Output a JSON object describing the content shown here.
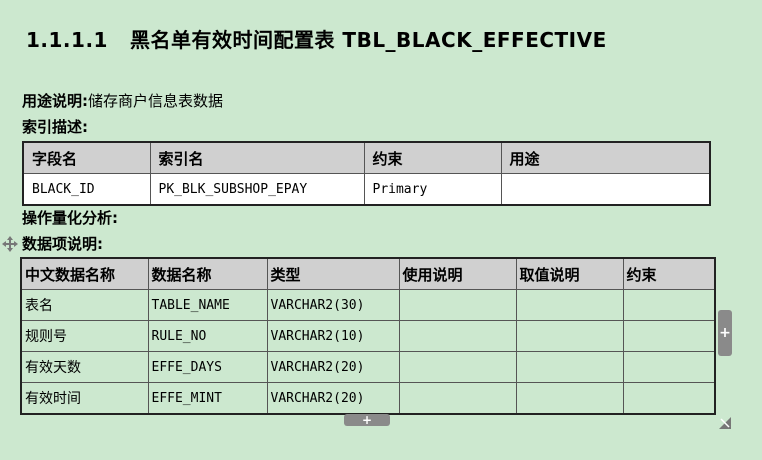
{
  "heading": {
    "number": "1.1.1.1",
    "title": "黑名单有效时间配置表 TBL_BLACK_EFFECTIVE"
  },
  "purpose": {
    "label": "用途说明:",
    "value": "储存商户信息表数据"
  },
  "index_label": "索引描述:",
  "index_table": {
    "headers": [
      "字段名",
      "索引名",
      "约束",
      "用途"
    ],
    "rows": [
      [
        "BLACK_ID",
        "PK_BLK_SUBSHOP_EPAY",
        "Primary",
        ""
      ]
    ]
  },
  "ops_label": "操作量化分析:",
  "items_label": "数据项说明:",
  "items_table": {
    "headers": [
      "中文数据名称",
      "数据名称",
      "类型",
      "使用说明",
      "取值说明",
      "约束"
    ],
    "rows": [
      [
        "表名",
        "TABLE_NAME",
        "VARCHAR2(30)",
        "",
        "",
        ""
      ],
      [
        "规则号",
        "RULE_NO",
        "VARCHAR2(10)",
        "",
        "",
        ""
      ],
      [
        "有效天数",
        "EFFE_DAYS",
        "VARCHAR2(20)",
        "",
        "",
        ""
      ],
      [
        "有效时间",
        "EFFE_MINT",
        "VARCHAR2(20)",
        "",
        "",
        ""
      ]
    ]
  },
  "icons": {
    "move_handle": "move-icon",
    "add_row": "plus-icon",
    "add_column": "plus-icon",
    "resize_handle": "resize-icon"
  }
}
